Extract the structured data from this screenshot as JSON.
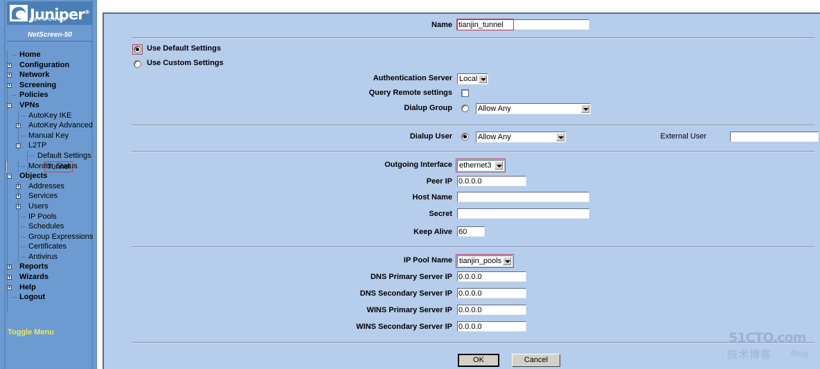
{
  "sidebar": {
    "brand": "Juniper",
    "brand_sub": "NETWORKS",
    "model": "NetScreen-50",
    "toggle_label": "Toggle Menu",
    "tree": [
      {
        "label": "Home",
        "level": 0,
        "toggle": "none"
      },
      {
        "label": "Configuration",
        "level": 0,
        "toggle": "plus"
      },
      {
        "label": "Network",
        "level": 0,
        "toggle": "plus"
      },
      {
        "label": "Screening",
        "level": 0,
        "toggle": "plus"
      },
      {
        "label": "Policies",
        "level": 0,
        "toggle": "none"
      },
      {
        "label": "VPNs",
        "level": 0,
        "toggle": "minus"
      },
      {
        "label": "AutoKey IKE",
        "level": 1,
        "toggle": "none"
      },
      {
        "label": "AutoKey Advanced",
        "level": 1,
        "toggle": "plus"
      },
      {
        "label": "Manual Key",
        "level": 1,
        "toggle": "none"
      },
      {
        "label": "L2TP",
        "level": 1,
        "toggle": "minus"
      },
      {
        "label": "Default Settings",
        "level": 2,
        "toggle": "none"
      },
      {
        "label": "Tunnel",
        "level": 2,
        "toggle": "none",
        "selected": true
      },
      {
        "label": "Monitor Status",
        "level": 1,
        "toggle": "none"
      },
      {
        "label": "Objects",
        "level": 0,
        "toggle": "minus"
      },
      {
        "label": "Addresses",
        "level": 1,
        "toggle": "plus"
      },
      {
        "label": "Services",
        "level": 1,
        "toggle": "plus"
      },
      {
        "label": "Users",
        "level": 1,
        "toggle": "plus"
      },
      {
        "label": "IP Pools",
        "level": 1,
        "toggle": "none"
      },
      {
        "label": "Schedules",
        "level": 1,
        "toggle": "none"
      },
      {
        "label": "Group Expressions",
        "level": 1,
        "toggle": "none"
      },
      {
        "label": "Certificates",
        "level": 1,
        "toggle": "none"
      },
      {
        "label": "Antivirus",
        "level": 1,
        "toggle": "none"
      },
      {
        "label": "Reports",
        "level": 0,
        "toggle": "plus"
      },
      {
        "label": "Wizards",
        "level": 0,
        "toggle": "plus"
      },
      {
        "label": "Help",
        "level": 0,
        "toggle": "plus"
      },
      {
        "label": "Logout",
        "level": 0,
        "toggle": "none"
      }
    ]
  },
  "form": {
    "name_label": "Name",
    "name_value": "tianjin_tunnel",
    "use_default_label": "Use Default Settings",
    "use_custom_label": "Use Custom Settings",
    "settings_mode": "default",
    "auth_server_label": "Authentication Server",
    "auth_server_value": "Local",
    "query_remote_label": "Query Remote settings",
    "query_remote_checked": false,
    "dialup_group_label": "Dialup Group",
    "dialup_group_value": "Allow Any",
    "dialup_group_selected": false,
    "dialup_user_label": "Dialup User",
    "dialup_user_value": "Allow Any",
    "dialup_user_selected": true,
    "external_user_label": "External User",
    "external_user_value": "",
    "outgoing_interface_label": "Outgoing Interface",
    "outgoing_interface_value": "ethernet3",
    "peer_ip_label": "Peer IP",
    "peer_ip_value": "0.0.0.0",
    "host_name_label": "Host Name",
    "host_name_value": "",
    "secret_label": "Secret",
    "secret_value": "",
    "keep_alive_label": "Keep Alive",
    "keep_alive_value": "60",
    "ip_pool_label": "IP Pool Name",
    "ip_pool_value": "tianjin_pools",
    "dns_primary_label": "DNS Primary Server IP",
    "dns_primary_value": "0.0.0.0",
    "dns_secondary_label": "DNS Secondary Server IP",
    "dns_secondary_value": "0.0.0.0",
    "wins_primary_label": "WINS Primary Server IP",
    "wins_primary_value": "0.0.0.0",
    "wins_secondary_label": "WINS Secondary Server IP",
    "wins_secondary_value": "0.0.0.0",
    "ok_label": "OK",
    "cancel_label": "Cancel"
  },
  "watermark": {
    "line1": "51CTO.com",
    "line2": "技术博客",
    "line3": "Blog"
  },
  "colors": {
    "sidebar_bg": "#6d9bd1",
    "panel_bg": "#b6cdeb",
    "highlight": "#b04a57",
    "toggle_text": "#e8e85c"
  }
}
